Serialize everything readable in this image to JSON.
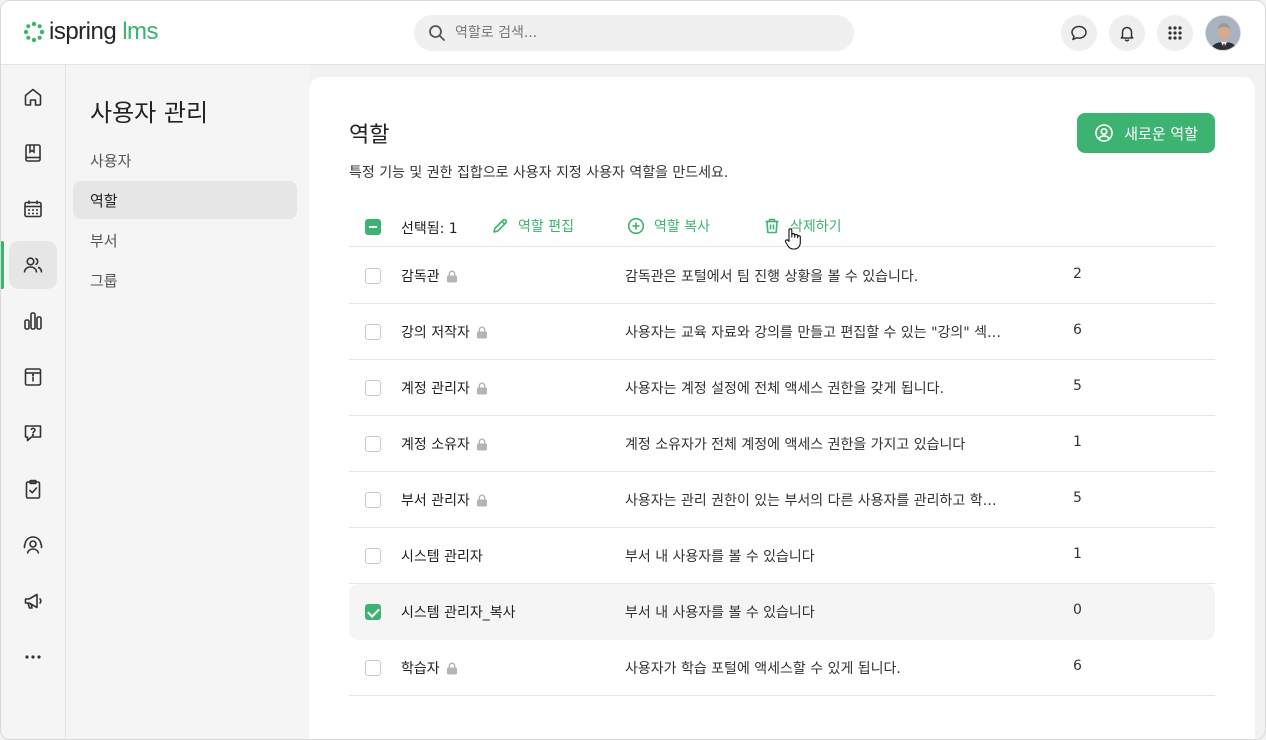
{
  "app": {
    "logo_text": "ispring",
    "logo_suffix": "lms"
  },
  "search": {
    "placeholder": "역할로 검색..."
  },
  "topbar": {
    "icons": [
      "chat-icon",
      "bell-icon",
      "apps-grid-icon"
    ],
    "avatar": "user-avatar"
  },
  "rail": {
    "items": [
      "home-icon",
      "book-icon",
      "calendar-icon",
      "users-icon",
      "reports-icon",
      "info-panel-icon",
      "help-chat-icon",
      "clipboard-check-icon",
      "instructor-icon",
      "megaphone-icon",
      "more-icon"
    ],
    "active_index": 3
  },
  "subnav": {
    "title": "사용자 관리",
    "items": [
      {
        "label": "사용자"
      },
      {
        "label": "역할"
      },
      {
        "label": "부서"
      },
      {
        "label": "그룹"
      }
    ],
    "active_index": 1
  },
  "page": {
    "title": "역할",
    "description": "특정 기능 및 권한 집합으로 사용자 지정 사용자 역할을 만드세요.",
    "new_button": "새로운 역할"
  },
  "toolbar": {
    "selected_label": "선택됨: 1",
    "edit_label": "역할 편집",
    "copy_label": "역할 복사",
    "delete_label": "삭제하기"
  },
  "roles": [
    {
      "name": "감독관",
      "locked": true,
      "description": "감독관은 포털에서 팀 진행 상황을 볼 수 있습니다.",
      "count": "2",
      "checked": false
    },
    {
      "name": "강의 저작자",
      "locked": true,
      "description": "사용자는 교육 자료와 강의를 만들고 편집할 수 있는 \"강의\" 섹…",
      "count": "6",
      "checked": false
    },
    {
      "name": "계정 관리자",
      "locked": true,
      "description": "사용자는 계정 설정에 전체 액세스 권한을 갖게 됩니다.",
      "count": "5",
      "checked": false
    },
    {
      "name": "계정 소유자",
      "locked": true,
      "description": "계정 소유자가 전체 계정에 액세스 권한을 가지고 있습니다",
      "count": "1",
      "checked": false
    },
    {
      "name": "부서 관리자",
      "locked": true,
      "description": "사용자는 관리 권한이 있는 부서의 다른 사용자를 관리하고 학…",
      "count": "5",
      "checked": false
    },
    {
      "name": "시스템 관리자",
      "locked": false,
      "description": "부서 내 사용자를 볼 수 있습니다",
      "count": "1",
      "checked": false
    },
    {
      "name": "시스템 관리자_복사",
      "locked": false,
      "description": "부서 내 사용자를 볼 수 있습니다",
      "count": "0",
      "checked": true
    },
    {
      "name": "학습자",
      "locked": true,
      "description": "사용자가 학습 포털에 액세스할 수 있게 됩니다.",
      "count": "6",
      "checked": false
    }
  ],
  "colors": {
    "accent": "#3cb371",
    "lock": "#b5b5b5"
  }
}
